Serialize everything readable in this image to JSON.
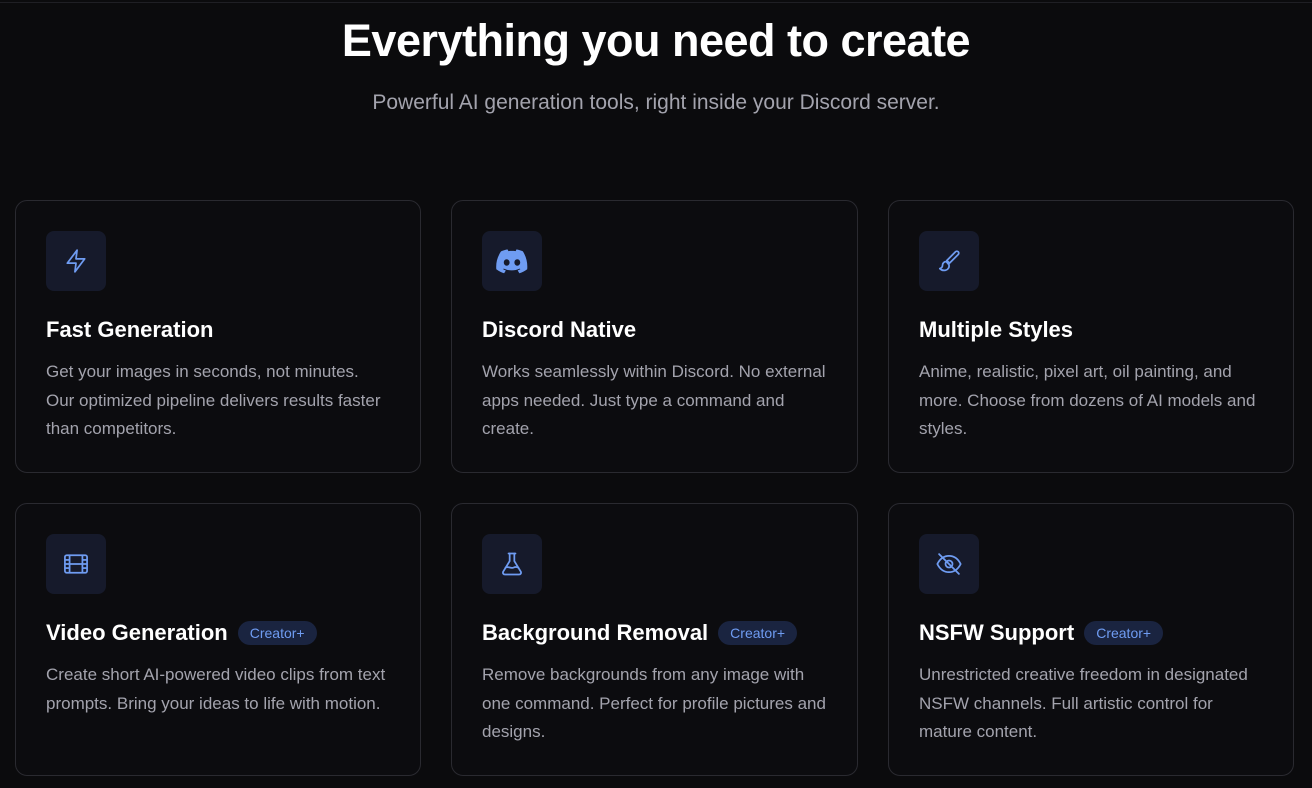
{
  "header": {
    "title": "Everything you need to create",
    "subtitle": "Powerful AI generation tools, right inside your Discord server."
  },
  "accent_color": "#6f9cf2",
  "features": [
    {
      "icon": "lightning-icon",
      "title": "Fast Generation",
      "badge": "",
      "description": "Get your images in seconds, not minutes. Our optimized pipeline delivers results faster than competitors."
    },
    {
      "icon": "discord-icon",
      "title": "Discord Native",
      "badge": "",
      "description": "Works seamlessly within Discord. No external apps needed. Just type a command and create."
    },
    {
      "icon": "paintbrush-icon",
      "title": "Multiple Styles",
      "badge": "",
      "description": "Anime, realistic, pixel art, oil painting, and more. Choose from dozens of AI models and styles."
    },
    {
      "icon": "film-icon",
      "title": "Video Generation",
      "badge": "Creator+",
      "description": "Create short AI-powered video clips from text prompts. Bring your ideas to life with motion."
    },
    {
      "icon": "flask-icon",
      "title": "Background Removal",
      "badge": "Creator+",
      "description": "Remove backgrounds from any image with one command. Perfect for profile pictures and designs."
    },
    {
      "icon": "eye-off-icon",
      "title": "NSFW Support",
      "badge": "Creator+",
      "description": "Unrestricted creative freedom in designated NSFW channels. Full artistic control for mature content."
    }
  ]
}
